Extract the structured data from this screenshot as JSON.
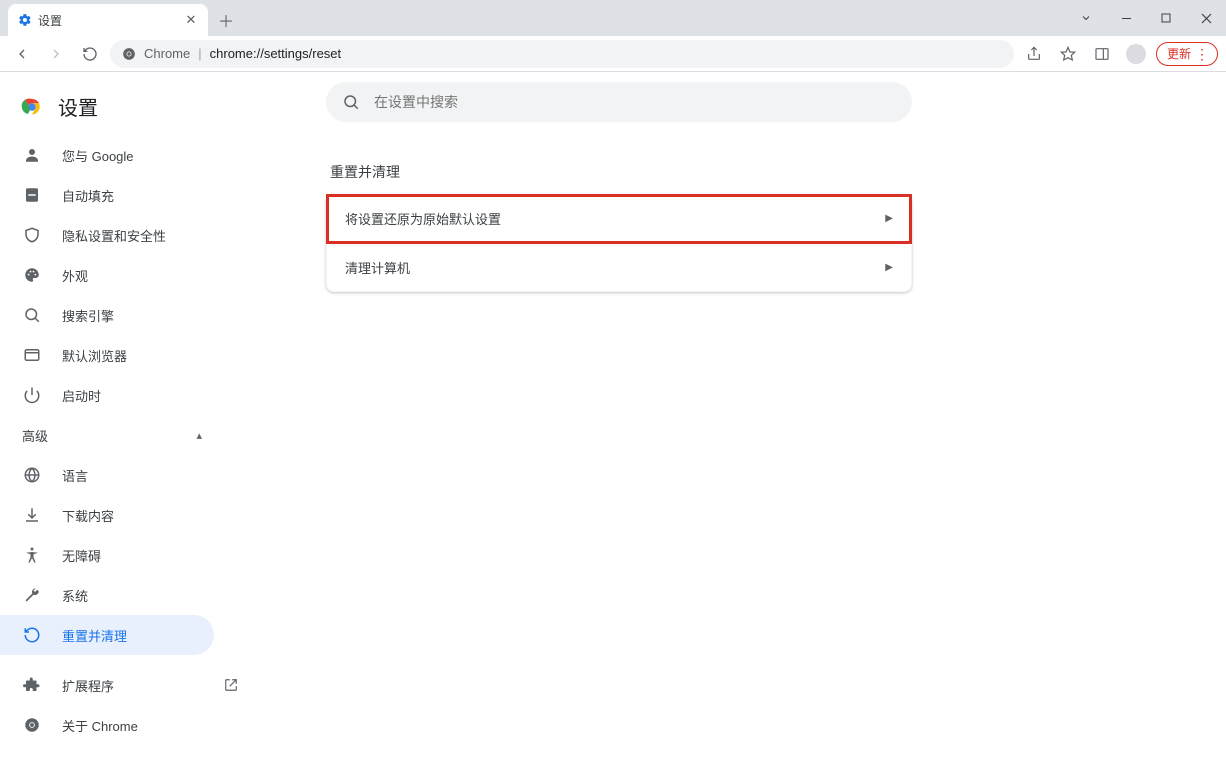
{
  "tab": {
    "title": "设置"
  },
  "address": {
    "product": "Chrome",
    "url": "chrome://settings/reset"
  },
  "update_label": "更新",
  "settings_title": "设置",
  "search_placeholder": "在设置中搜索",
  "sidebar": {
    "items": [
      {
        "label": "您与 Google"
      },
      {
        "label": "自动填充"
      },
      {
        "label": "隐私设置和安全性"
      },
      {
        "label": "外观"
      },
      {
        "label": "搜索引擎"
      },
      {
        "label": "默认浏览器"
      },
      {
        "label": "启动时"
      }
    ],
    "advanced_label": "高级",
    "adv_items": [
      {
        "label": "语言"
      },
      {
        "label": "下载内容"
      },
      {
        "label": "无障碍"
      },
      {
        "label": "系统"
      },
      {
        "label": "重置并清理"
      }
    ],
    "footer": [
      {
        "label": "扩展程序"
      },
      {
        "label": "关于 Chrome"
      }
    ]
  },
  "section": {
    "title": "重置并清理",
    "rows": [
      {
        "label": "将设置还原为原始默认设置"
      },
      {
        "label": "清理计算机"
      }
    ]
  }
}
